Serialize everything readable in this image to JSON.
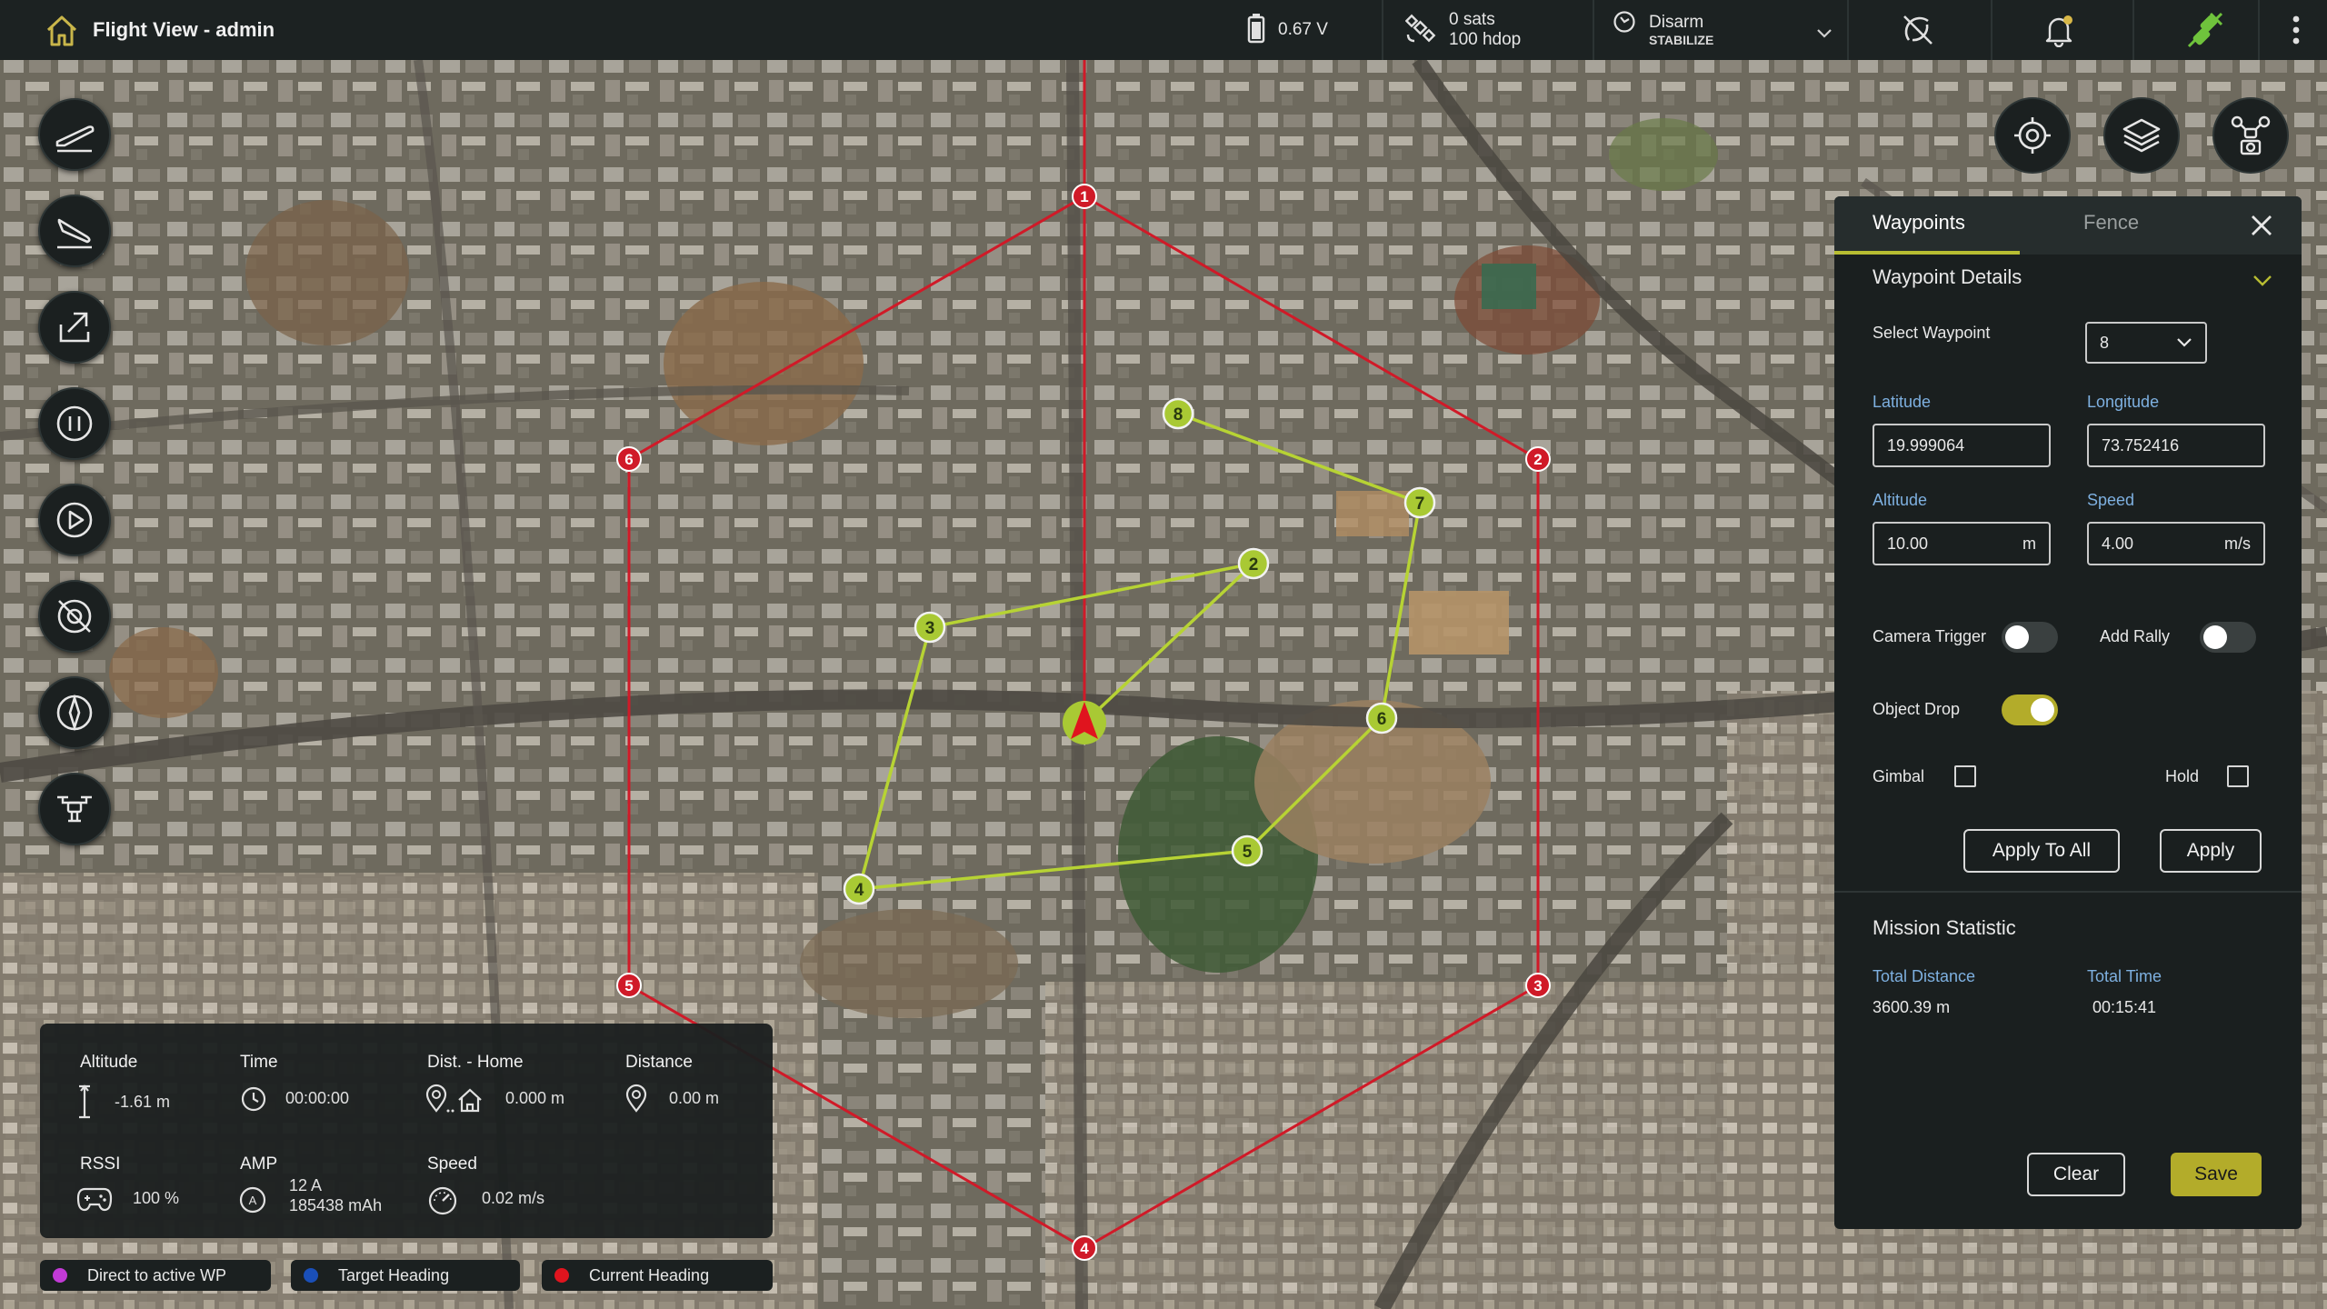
{
  "app": {
    "title": "Flight View - admin"
  },
  "status": {
    "voltage": "0.67 V",
    "sats": "0 sats",
    "hdop": "100 hdop",
    "arm_state": "Disarm",
    "flight_mode": "STABILIZE"
  },
  "map_controls": [
    {
      "name": "locate-icon"
    },
    {
      "name": "layers-icon"
    },
    {
      "name": "drone-camera-icon"
    }
  ],
  "left_tools": [
    {
      "name": "takeoff-icon"
    },
    {
      "name": "land-icon"
    },
    {
      "name": "return-home-icon"
    },
    {
      "name": "pause-icon"
    },
    {
      "name": "play-icon"
    },
    {
      "name": "no-camera-icon"
    },
    {
      "name": "compass-icon"
    },
    {
      "name": "drone-icon"
    }
  ],
  "telemetry": {
    "altitude": {
      "label": "Altitude",
      "value": "-1.61 m"
    },
    "time": {
      "label": "Time",
      "value": "00:00:00"
    },
    "dist_home": {
      "label": "Dist. - Home",
      "value": "0.000 m"
    },
    "distance": {
      "label": "Distance",
      "value": "0.00 m"
    },
    "rssi": {
      "label": "RSSI",
      "value": "100 %"
    },
    "amp": {
      "label": "AMP",
      "value_current": "12 A",
      "value_capacity": "185438 mAh"
    },
    "speed": {
      "label": "Speed",
      "value": "0.02 m/s"
    }
  },
  "legend": [
    {
      "label": "Direct to active WP",
      "color": "#c23ad6"
    },
    {
      "label": "Target Heading",
      "color": "#1a4fb8"
    },
    {
      "label": "Current Heading",
      "color": "#e0141e"
    }
  ],
  "panel": {
    "tabs": [
      {
        "label": "Waypoints",
        "active": true
      },
      {
        "label": "Fence",
        "active": false
      }
    ],
    "waypoint_details_title": "Waypoint Details",
    "select_waypoint_label": "Select Waypoint",
    "selected_waypoint": "8",
    "latitude_label": "Latitude",
    "latitude": "19.999064",
    "longitude_label": "Longitude",
    "longitude": "73.752416",
    "altitude_label": "Altitude",
    "altitude": "10.00",
    "altitude_unit": "m",
    "speed_label": "Speed",
    "speed": "4.00",
    "speed_unit": "m/s",
    "camera_trigger_label": "Camera Trigger",
    "camera_trigger_on": false,
    "add_rally_label": "Add Rally",
    "add_rally_on": false,
    "object_drop_label": "Object Drop",
    "object_drop_on": true,
    "gimbal_label": "Gimbal",
    "hold_label": "Hold",
    "apply_all_label": "Apply To All",
    "apply_label": "Apply",
    "mission_title": "Mission Statistic",
    "total_distance_label": "Total Distance",
    "total_distance": "3600.39 m",
    "total_time_label": "Total Time",
    "total_time": "00:15:41",
    "clear_label": "Clear",
    "save_label": "Save"
  },
  "fence_points": [
    "1",
    "2",
    "3",
    "4",
    "5",
    "6"
  ],
  "mission_waypoints": [
    "2",
    "3",
    "4",
    "5",
    "6",
    "7",
    "8"
  ],
  "colors": {
    "accent": "#b8bd32",
    "fence": "#d01a28",
    "route": "#b7d334",
    "label_blue": "#6fa8dc"
  }
}
